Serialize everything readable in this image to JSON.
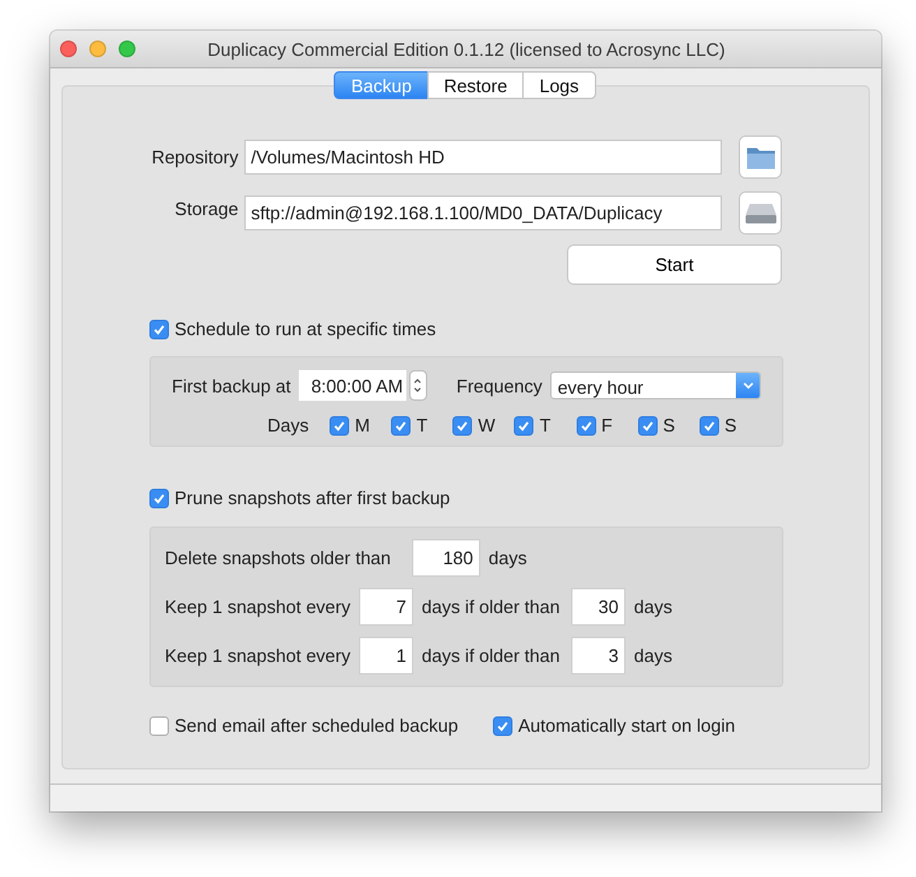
{
  "window": {
    "title": "Duplicacy Commercial Edition 0.1.12 (licensed to Acrosync LLC)"
  },
  "tabs": [
    {
      "label": "Backup",
      "selected": true
    },
    {
      "label": "Restore",
      "selected": false
    },
    {
      "label": "Logs",
      "selected": false
    }
  ],
  "repository": {
    "label": "Repository",
    "value": "/Volumes/Macintosh HD"
  },
  "storage": {
    "label": "Storage",
    "value": "sftp://admin@192.168.1.100/MD0_DATA/Duplicacy"
  },
  "start_button": "Start",
  "schedule": {
    "label": "Schedule to run at specific times",
    "checked": true,
    "first_backup_label": "First backup at",
    "time": "8:00:00 AM",
    "frequency_label": "Frequency",
    "frequency": "every hour",
    "days_label": "Days",
    "days": [
      {
        "label": "M",
        "checked": true
      },
      {
        "label": "T",
        "checked": true
      },
      {
        "label": "W",
        "checked": true
      },
      {
        "label": "T",
        "checked": true
      },
      {
        "label": "F",
        "checked": true
      },
      {
        "label": "S",
        "checked": true
      },
      {
        "label": "S",
        "checked": true
      }
    ]
  },
  "prune": {
    "label": "Prune snapshots after first backup",
    "checked": true,
    "rules": [
      [
        {
          "kind": "text",
          "text": "Delete snapshots older than"
        },
        {
          "kind": "field",
          "value": "180"
        },
        {
          "kind": "text",
          "text": "days"
        }
      ],
      [
        {
          "kind": "text",
          "text": "Keep 1 snapshot every"
        },
        {
          "kind": "field",
          "value": "7"
        },
        {
          "kind": "text",
          "text": "days if older than"
        },
        {
          "kind": "field",
          "value": "30"
        },
        {
          "kind": "text",
          "text": "days"
        }
      ],
      [
        {
          "kind": "text",
          "text": "Keep 1 snapshot every"
        },
        {
          "kind": "field",
          "value": "1"
        },
        {
          "kind": "text",
          "text": "days if older than"
        },
        {
          "kind": "field",
          "value": "3"
        },
        {
          "kind": "text",
          "text": "days"
        }
      ]
    ]
  },
  "options": [
    {
      "label": "Send email after scheduled backup",
      "checked": false
    },
    {
      "label": "Automatically start on login",
      "checked": true
    }
  ]
}
